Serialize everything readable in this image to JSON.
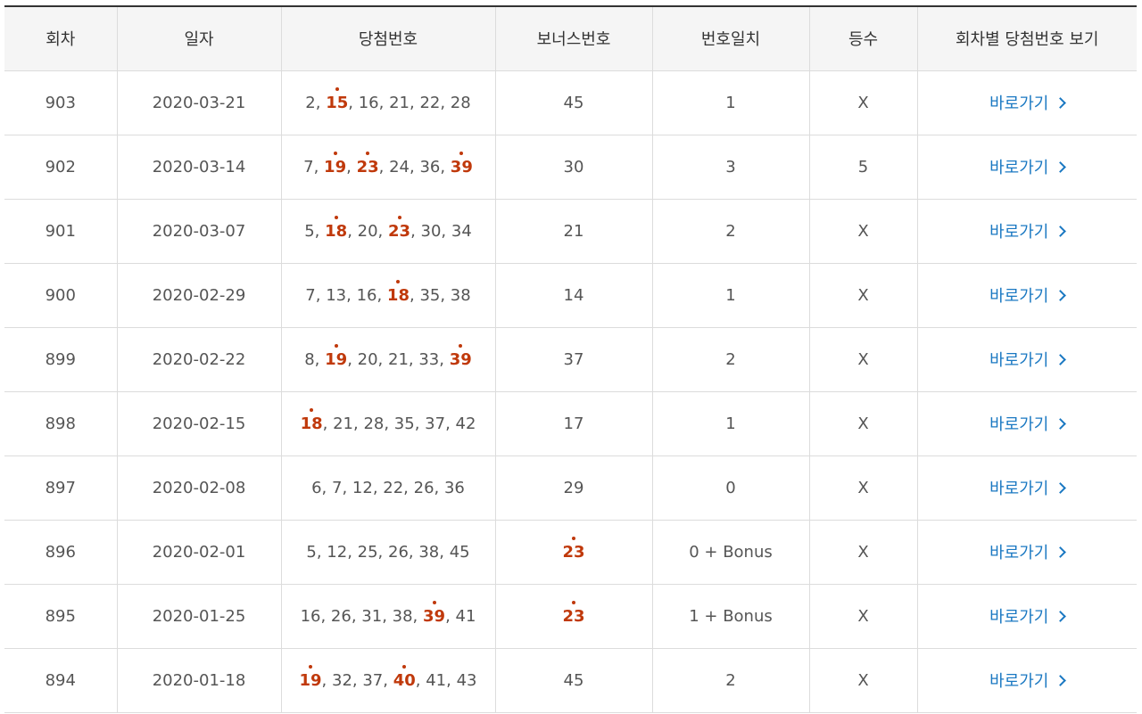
{
  "headers": [
    "회차",
    "일자",
    "당첨번호",
    "보너스번호",
    "번호일치",
    "등수",
    "회차별 당첨번호 보기"
  ],
  "link_label": "바로가기",
  "rows": [
    {
      "round": "903",
      "date": "2020-03-21",
      "numbers": [
        {
          "n": "2"
        },
        {
          "n": "15",
          "hit": true
        },
        {
          "n": "16"
        },
        {
          "n": "21"
        },
        {
          "n": "22"
        },
        {
          "n": "28"
        }
      ],
      "bonus": {
        "n": "45"
      },
      "match": "1",
      "rank": "X"
    },
    {
      "round": "902",
      "date": "2020-03-14",
      "numbers": [
        {
          "n": "7"
        },
        {
          "n": "19",
          "hit": true
        },
        {
          "n": "23",
          "hit": true
        },
        {
          "n": "24"
        },
        {
          "n": "36"
        },
        {
          "n": "39",
          "hit": true
        }
      ],
      "bonus": {
        "n": "30"
      },
      "match": "3",
      "rank": "5"
    },
    {
      "round": "901",
      "date": "2020-03-07",
      "numbers": [
        {
          "n": "5"
        },
        {
          "n": "18",
          "hit": true
        },
        {
          "n": "20"
        },
        {
          "n": "23",
          "hit": true
        },
        {
          "n": "30"
        },
        {
          "n": "34"
        }
      ],
      "bonus": {
        "n": "21"
      },
      "match": "2",
      "rank": "X"
    },
    {
      "round": "900",
      "date": "2020-02-29",
      "numbers": [
        {
          "n": "7"
        },
        {
          "n": "13"
        },
        {
          "n": "16"
        },
        {
          "n": "18",
          "hit": true
        },
        {
          "n": "35"
        },
        {
          "n": "38"
        }
      ],
      "bonus": {
        "n": "14"
      },
      "match": "1",
      "rank": "X"
    },
    {
      "round": "899",
      "date": "2020-02-22",
      "numbers": [
        {
          "n": "8"
        },
        {
          "n": "19",
          "hit": true
        },
        {
          "n": "20"
        },
        {
          "n": "21"
        },
        {
          "n": "33"
        },
        {
          "n": "39",
          "hit": true
        }
      ],
      "bonus": {
        "n": "37"
      },
      "match": "2",
      "rank": "X"
    },
    {
      "round": "898",
      "date": "2020-02-15",
      "numbers": [
        {
          "n": "18",
          "hit": true
        },
        {
          "n": "21"
        },
        {
          "n": "28"
        },
        {
          "n": "35"
        },
        {
          "n": "37"
        },
        {
          "n": "42"
        }
      ],
      "bonus": {
        "n": "17"
      },
      "match": "1",
      "rank": "X"
    },
    {
      "round": "897",
      "date": "2020-02-08",
      "numbers": [
        {
          "n": "6"
        },
        {
          "n": "7"
        },
        {
          "n": "12"
        },
        {
          "n": "22"
        },
        {
          "n": "26"
        },
        {
          "n": "36"
        }
      ],
      "bonus": {
        "n": "29"
      },
      "match": "0",
      "rank": "X"
    },
    {
      "round": "896",
      "date": "2020-02-01",
      "numbers": [
        {
          "n": "5"
        },
        {
          "n": "12"
        },
        {
          "n": "25"
        },
        {
          "n": "26"
        },
        {
          "n": "38"
        },
        {
          "n": "45"
        }
      ],
      "bonus": {
        "n": "23",
        "hit": true
      },
      "match": "0 + Bonus",
      "rank": "X"
    },
    {
      "round": "895",
      "date": "2020-01-25",
      "numbers": [
        {
          "n": "16"
        },
        {
          "n": "26"
        },
        {
          "n": "31"
        },
        {
          "n": "38"
        },
        {
          "n": "39",
          "hit": true
        },
        {
          "n": "41"
        }
      ],
      "bonus": {
        "n": "23",
        "hit": true
      },
      "match": "1 + Bonus",
      "rank": "X"
    },
    {
      "round": "894",
      "date": "2020-01-18",
      "numbers": [
        {
          "n": "19",
          "hit": true
        },
        {
          "n": "32"
        },
        {
          "n": "37"
        },
        {
          "n": "40",
          "hit": true
        },
        {
          "n": "41"
        },
        {
          "n": "43"
        }
      ],
      "bonus": {
        "n": "45"
      },
      "match": "2",
      "rank": "X"
    }
  ],
  "colors": {
    "hit": "#c0390b",
    "link": "#1a78c2",
    "header_bg": "#f5f5f5",
    "border": "#dcdcdc"
  },
  "icons": {
    "link_arrow": "chevron-right-icon",
    "hit_marker": "dot-icon"
  }
}
